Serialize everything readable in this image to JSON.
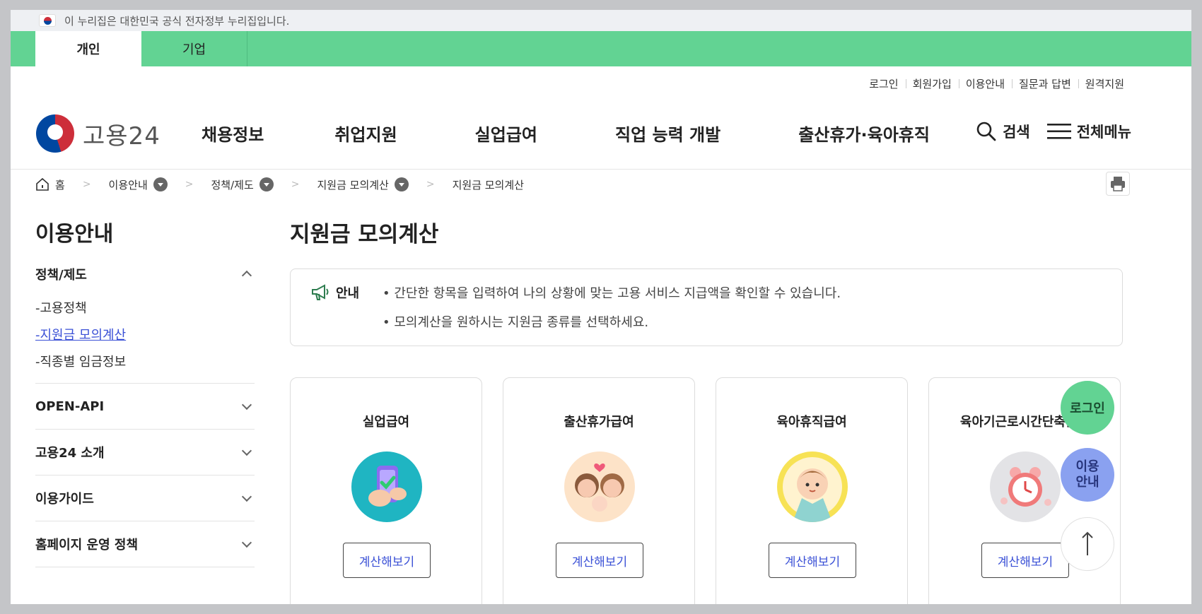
{
  "gov_banner": {
    "text": "이 누리집은 대한민국 공식 전자정부 누리집입니다."
  },
  "user_tabs": [
    {
      "label": "개인"
    },
    {
      "label": "기업"
    }
  ],
  "util_links": [
    {
      "label": "로그인"
    },
    {
      "label": "회원가입"
    },
    {
      "label": "이용안내"
    },
    {
      "label": "질문과 답변"
    },
    {
      "label": "원격지원"
    }
  ],
  "logo": {
    "text": "고용24"
  },
  "gnb": [
    {
      "label": "채용정보"
    },
    {
      "label": "취업지원"
    },
    {
      "label": "실업급여"
    },
    {
      "label": "직업 능력 개발"
    },
    {
      "label": "출산휴가·육아휴직"
    }
  ],
  "header_tools": {
    "search": "검색",
    "menu": "전체메뉴"
  },
  "breadcrumb": {
    "home": "홈",
    "items": [
      {
        "label": "이용안내"
      },
      {
        "label": "정책/제도"
      },
      {
        "label": "지원금 모의계산"
      }
    ],
    "current": "지원금 모의계산"
  },
  "sidebar": {
    "title": "이용안내",
    "group_open": "정책/제도",
    "sub_items": [
      {
        "label": "-고용정책"
      },
      {
        "label": "-지원금 모의계산"
      },
      {
        "label": "-직종별 임금정보"
      }
    ],
    "groups": [
      {
        "label": "OPEN-API"
      },
      {
        "label": "고용24 소개"
      },
      {
        "label": "이용가이드"
      },
      {
        "label": "홈페이지 운영 정책"
      }
    ]
  },
  "page_title": "지원금 모의계산",
  "notice": {
    "label": "안내",
    "lines": [
      "• 간단한 항목을 입력하여 나의 상황에 맞는 고용 서비스 지급액을 확인할 수 있습니다.",
      "• 모의계산을 원하시는 지원금 종류를 선택하세요."
    ]
  },
  "cards": [
    {
      "title": "실업급여",
      "button": "계산해보기",
      "icon": "phone-check-icon",
      "bg": "#1fb5c2"
    },
    {
      "title": "출산휴가급여",
      "button": "계산해보기",
      "icon": "parents-baby-icon",
      "bg": "#fde3c8"
    },
    {
      "title": "육아휴직급여",
      "button": "계산해보기",
      "icon": "baby-icon",
      "bg": "#f7e255"
    },
    {
      "title": "육아기근로시간단축급여",
      "button": "계산해보기",
      "icon": "alarm-clock-icon",
      "bg": "#e3e3e6"
    }
  ],
  "floating": {
    "login": "로그인",
    "guide_line1": "이용",
    "guide_line2": "안내"
  }
}
